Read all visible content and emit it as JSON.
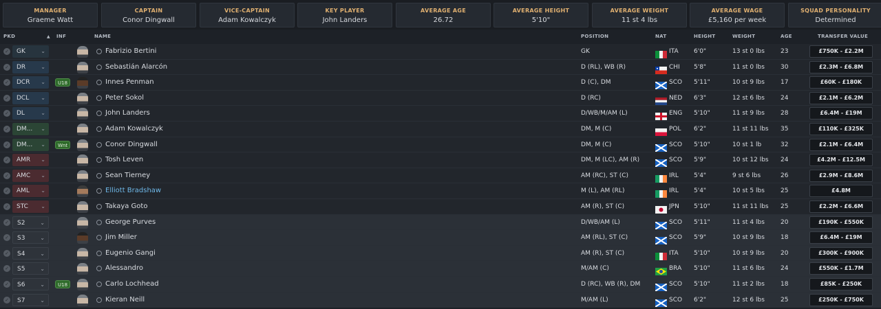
{
  "summary": [
    {
      "title": "MANAGER",
      "value": "Graeme Watt"
    },
    {
      "title": "CAPTAIN",
      "value": "Conor Dingwall"
    },
    {
      "title": "VICE-CAPTAIN",
      "value": "Adam Kowalczyk"
    },
    {
      "title": "KEY PLAYER",
      "value": "John Landers"
    },
    {
      "title": "AVERAGE AGE",
      "value": "26.72"
    },
    {
      "title": "AVERAGE HEIGHT",
      "value": "5'10\""
    },
    {
      "title": "AVERAGE WEIGHT",
      "value": "11 st 4 lbs"
    },
    {
      "title": "AVERAGE WAGE",
      "value": "£5,160 per week"
    },
    {
      "title": "SQUAD PERSONALITY",
      "value": "Determined"
    }
  ],
  "columns": {
    "pkd": "PKD",
    "inf": "INF",
    "name": "NAME",
    "position": "POSITION",
    "nat": "NAT",
    "height": "HEIGHT",
    "weight": "WEIGHT",
    "age": "AGE",
    "transfer_value": "TRANSFER VALUE",
    "sort_icon": "sort-ascending-icon"
  },
  "colors": {
    "goalkeeper_slot": "#27343e",
    "defender_slot": "#27394b",
    "midfielder_slot": "#2b4535",
    "attacker_slot": "#4b2b30",
    "card_title": "#e0b070",
    "link": "#6fb8e8",
    "tag_green": "#2f6b2b"
  },
  "players": [
    {
      "slot": "GK",
      "role": "gk",
      "inf": "",
      "face": "light",
      "name": "Fabrizio Bertini",
      "position": "GK",
      "nat": "ITA",
      "flag": "italy",
      "height": "6'0\"",
      "weight": "13 st 0 lbs",
      "age": "23",
      "value": "£750K - £2.2M",
      "sub": false,
      "link": false
    },
    {
      "slot": "DR",
      "role": "def",
      "inf": "",
      "face": "light",
      "name": "Sebastián Alarcón",
      "position": "D (RL), WB (R)",
      "nat": "CHI",
      "flag": "chile",
      "height": "5'8\"",
      "weight": "11 st 0 lbs",
      "age": "30",
      "value": "£2.3M - £6.8M",
      "sub": false,
      "link": false
    },
    {
      "slot": "DCR",
      "role": "def",
      "inf": "U18",
      "face": "dark",
      "name": "Innes Penman",
      "position": "D (C), DM",
      "nat": "SCO",
      "flag": "scotland",
      "height": "5'11\"",
      "weight": "10 st 9 lbs",
      "age": "17",
      "value": "£60K - £180K",
      "sub": false,
      "link": false
    },
    {
      "slot": "DCL",
      "role": "def",
      "inf": "",
      "face": "light",
      "name": "Peter Sokol",
      "position": "D (RC)",
      "nat": "NED",
      "flag": "netherlands",
      "height": "6'3\"",
      "weight": "12 st 6 lbs",
      "age": "24",
      "value": "£2.1M - £6.2M",
      "sub": false,
      "link": false
    },
    {
      "slot": "DL",
      "role": "def",
      "inf": "",
      "face": "light",
      "name": "John Landers",
      "position": "D/WB/M/AM (L)",
      "nat": "ENG",
      "flag": "england",
      "height": "5'10\"",
      "weight": "11 st 9 lbs",
      "age": "28",
      "value": "£6.4M - £19M",
      "sub": false,
      "link": false
    },
    {
      "slot": "DM...",
      "role": "mid",
      "inf": "",
      "face": "light",
      "name": "Adam Kowalczyk",
      "position": "DM, M (C)",
      "nat": "POL",
      "flag": "poland",
      "height": "6'2\"",
      "weight": "11 st 11 lbs",
      "age": "35",
      "value": "£110K - £325K",
      "sub": false,
      "link": false
    },
    {
      "slot": "DM...",
      "role": "mid",
      "inf": "Wnt",
      "face": "light",
      "name": "Conor Dingwall",
      "position": "DM, M (C)",
      "nat": "SCO",
      "flag": "scotland",
      "height": "5'10\"",
      "weight": "10 st 1 lb",
      "age": "32",
      "value": "£2.1M - £6.4M",
      "sub": false,
      "link": false
    },
    {
      "slot": "AMR",
      "role": "att",
      "inf": "",
      "face": "light",
      "name": "Tosh Leven",
      "position": "DM, M (LC), AM (R)",
      "nat": "SCO",
      "flag": "scotland",
      "height": "5'9\"",
      "weight": "10 st 12 lbs",
      "age": "24",
      "value": "£4.2M - £12.5M",
      "sub": false,
      "link": false
    },
    {
      "slot": "AMC",
      "role": "att",
      "inf": "",
      "face": "light",
      "name": "Sean Tierney",
      "position": "AM (RC), ST (C)",
      "nat": "IRL",
      "flag": "ireland",
      "height": "5'4\"",
      "weight": "9 st 6 lbs",
      "age": "26",
      "value": "£2.9M - £8.6M",
      "sub": false,
      "link": false
    },
    {
      "slot": "AML",
      "role": "att",
      "inf": "",
      "face": "mid",
      "name": "Elliott Bradshaw",
      "position": "M (L), AM (RL)",
      "nat": "IRL",
      "flag": "ireland",
      "height": "5'4\"",
      "weight": "10 st 5 lbs",
      "age": "25",
      "value": "£4.8M",
      "sub": false,
      "link": true
    },
    {
      "slot": "STC",
      "role": "att",
      "inf": "",
      "face": "light",
      "name": "Takaya Goto",
      "position": "AM (R), ST (C)",
      "nat": "JPN",
      "flag": "japan",
      "height": "5'10\"",
      "weight": "11 st 11 lbs",
      "age": "25",
      "value": "£2.2M - £6.6M",
      "sub": false,
      "link": false
    },
    {
      "slot": "S2",
      "role": "subp",
      "inf": "",
      "face": "light",
      "name": "George Purves",
      "position": "D/WB/AM (L)",
      "nat": "SCO",
      "flag": "scotland",
      "height": "5'11\"",
      "weight": "11 st 4 lbs",
      "age": "20",
      "value": "£190K - £550K",
      "sub": true,
      "link": false
    },
    {
      "slot": "S3",
      "role": "subp",
      "inf": "",
      "face": "dark",
      "name": "Jim Miller",
      "position": "AM (RL), ST (C)",
      "nat": "SCO",
      "flag": "scotland",
      "height": "5'9\"",
      "weight": "10 st 9 lbs",
      "age": "18",
      "value": "£6.4M - £19M",
      "sub": true,
      "link": false
    },
    {
      "slot": "S4",
      "role": "subp",
      "inf": "",
      "face": "light",
      "name": "Eugenio Gangi",
      "position": "AM (R), ST (C)",
      "nat": "ITA",
      "flag": "italy",
      "height": "5'10\"",
      "weight": "10 st 9 lbs",
      "age": "20",
      "value": "£300K - £900K",
      "sub": true,
      "link": false
    },
    {
      "slot": "S5",
      "role": "subp",
      "inf": "",
      "face": "light",
      "name": "Alessandro",
      "position": "M/AM (C)",
      "nat": "BRA",
      "flag": "brazil",
      "height": "5'10\"",
      "weight": "11 st 6 lbs",
      "age": "24",
      "value": "£550K - £1.7M",
      "sub": true,
      "link": false
    },
    {
      "slot": "S6",
      "role": "subp",
      "inf": "U18",
      "face": "light",
      "name": "Carlo Lochhead",
      "position": "D (RC), WB (R), DM",
      "nat": "SCO",
      "flag": "scotland",
      "height": "5'10\"",
      "weight": "11 st 2 lbs",
      "age": "18",
      "value": "£85K - £250K",
      "sub": true,
      "link": false
    },
    {
      "slot": "S7",
      "role": "subp",
      "inf": "",
      "face": "light",
      "name": "Kieran Neill",
      "position": "M/AM (L)",
      "nat": "SCO",
      "flag": "scotland",
      "height": "6'2\"",
      "weight": "12 st 6 lbs",
      "age": "25",
      "value": "£250K - £750K",
      "sub": true,
      "link": false
    }
  ]
}
